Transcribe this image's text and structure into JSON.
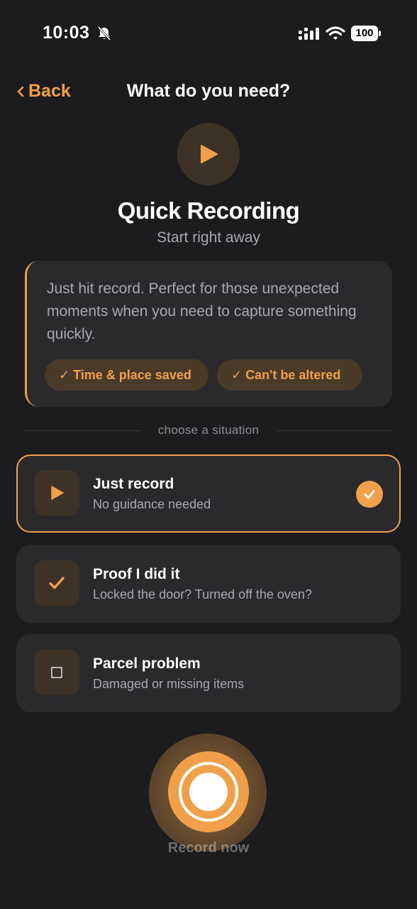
{
  "status_bar": {
    "time": "10:03",
    "battery": "100",
    "icons": [
      "bell-slash-icon",
      "signal-icon",
      "wifi-icon",
      "battery-icon"
    ]
  },
  "nav": {
    "back_label": "Back",
    "title": "What do you need?"
  },
  "hero": {
    "icon": "play-icon",
    "title": "Quick Recording",
    "subtitle": "Start right away"
  },
  "info_card": {
    "text": "Just hit record. Perfect for those unexpected moments when you need to capture something quickly.",
    "tags": [
      "✓ Time & place saved",
      "✓ Can't be altered"
    ]
  },
  "divider_label": "choose a situation",
  "options": [
    {
      "title": "Just record",
      "subtitle": "No guidance needed",
      "icon": "play-icon",
      "selected": true
    },
    {
      "title": "Proof I did it",
      "subtitle": "Locked the door? Turned off the oven?",
      "icon": "checkmark-icon",
      "selected": false
    },
    {
      "title": "Parcel problem",
      "subtitle": "Damaged or missing items",
      "icon": "box-icon",
      "selected": false
    }
  ],
  "record": {
    "label": "Record now"
  },
  "colors": {
    "accent": "#f0a04b",
    "background": "#1c1c1e",
    "card": "#2a2a2d",
    "icon_bg": "#3d3225",
    "muted_text": "#a8a8ad"
  }
}
